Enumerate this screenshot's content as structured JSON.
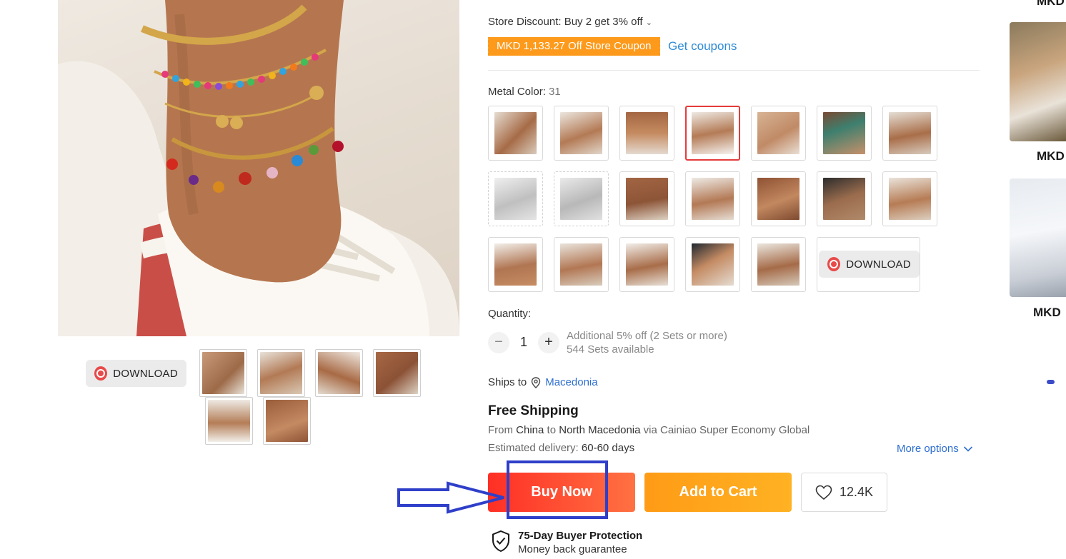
{
  "gallery": {
    "download_label": "DOWNLOAD",
    "thumb_count": 6
  },
  "store": {
    "discount_text": "Store Discount: Buy 2 get 3% off",
    "coupon_badge": "MKD 1,133.27 Off Store Coupon",
    "get_coupons": "Get coupons"
  },
  "metal_color": {
    "label": "Metal Color:",
    "selected_value": "31",
    "download_label": "DOWNLOAD"
  },
  "quantity": {
    "label": "Quantity:",
    "minus": "−",
    "plus": "+",
    "value": "1",
    "note_discount": "Additional 5% off (2 Sets or more)",
    "note_available": "544 Sets available"
  },
  "shipping": {
    "ships_to_label": "Ships to",
    "location": "Macedonia",
    "free_shipping": "Free Shipping",
    "from_label": "From",
    "origin": "China",
    "to_label": "to",
    "destination": "North Macedonia",
    "via_text": "via Cainiao Super Economy Global",
    "estimated_label": "Estimated delivery:",
    "estimated_value": "60-60 days",
    "more_options": "More options"
  },
  "actions": {
    "buy_now": "Buy Now",
    "add_to_cart": "Add to Cart",
    "wishlist_count": "12.4K"
  },
  "protection": {
    "title": "75-Day Buyer Protection",
    "subtitle": "Money back guarantee"
  },
  "recommendations": {
    "price_1": "MKD",
    "price_2": "MKD",
    "price_3": "MKD"
  },
  "colors": {
    "accent_red": "#ff2f25",
    "accent_orange": "#ff9b16",
    "link_blue": "#2e6fd1",
    "coupon_orange": "#fd9a1b",
    "annotation_blue": "#2f3fc9"
  }
}
